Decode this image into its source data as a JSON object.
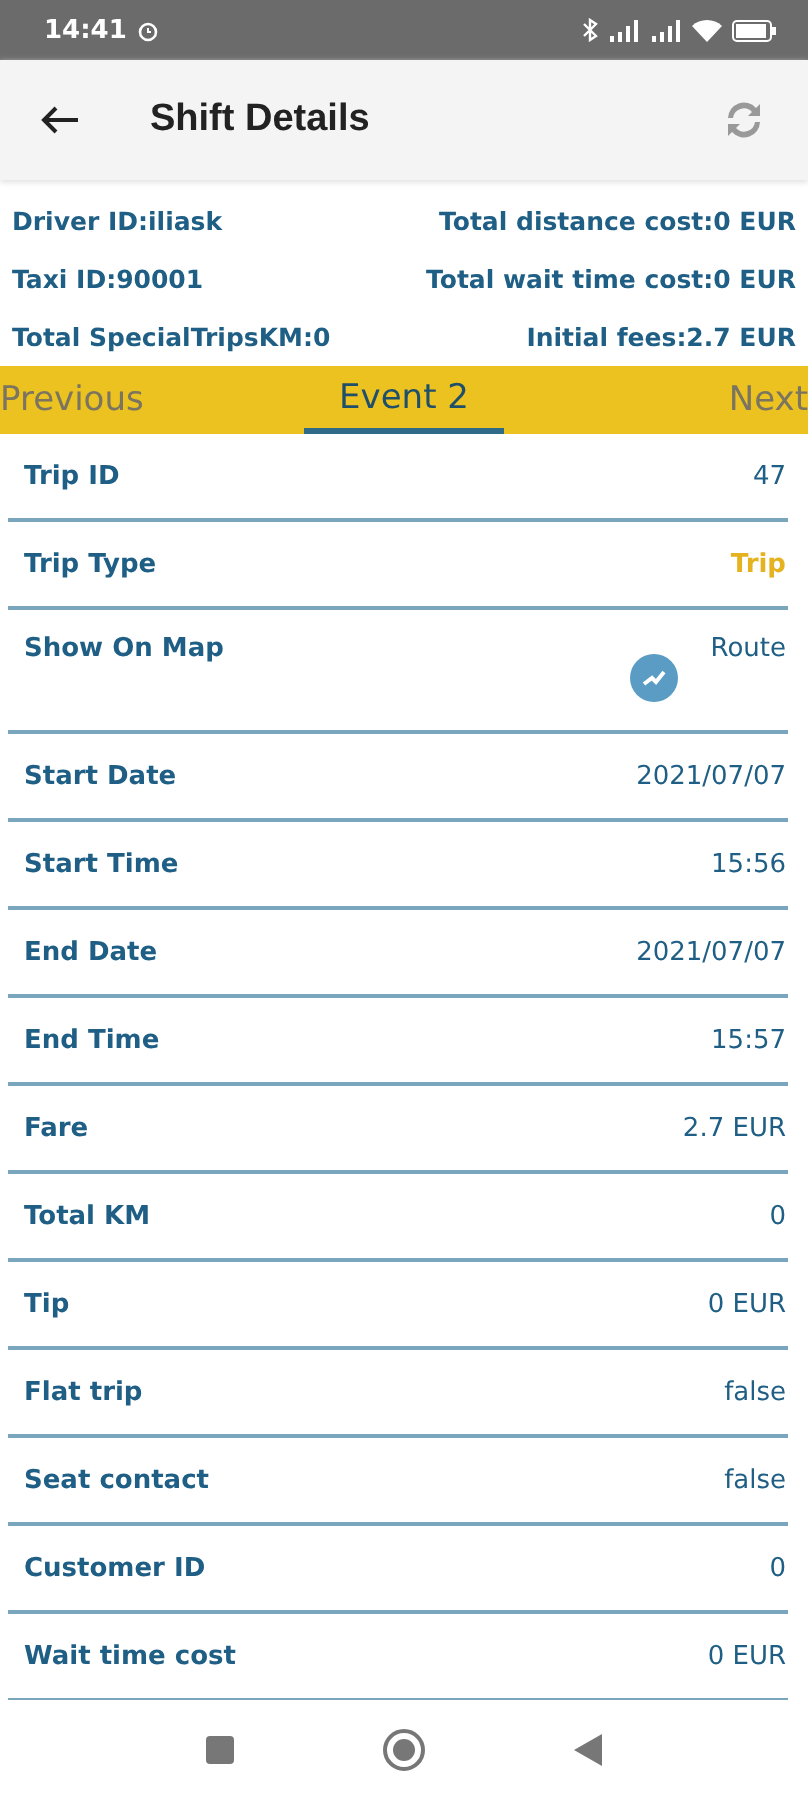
{
  "status_bar": {
    "time": "14:41"
  },
  "app_bar": {
    "title": "Shift Details"
  },
  "summary": [
    {
      "left": "Driver ID:iliask",
      "right": "Total distance cost:0 EUR"
    },
    {
      "left": "Taxi ID:90001",
      "right": "Total wait time cost:0 EUR"
    },
    {
      "left": "Total SpecialTripsKM:0",
      "right": "Initial fees:2.7 EUR"
    }
  ],
  "tabs": [
    {
      "label": "Previous",
      "selected": false
    },
    {
      "label": "Event 2",
      "selected": true
    },
    {
      "label": "Next",
      "selected": false
    }
  ],
  "rows": [
    {
      "kind": "text",
      "label": "Trip ID",
      "value": "47"
    },
    {
      "kind": "type",
      "label": "Trip Type",
      "value": "Trip"
    },
    {
      "kind": "map",
      "label": "Show On Map",
      "value": "Route"
    },
    {
      "kind": "text",
      "label": "Start Date",
      "value": "2021/07/07"
    },
    {
      "kind": "text",
      "label": "Start Time",
      "value": "15:56"
    },
    {
      "kind": "text",
      "label": "End Date",
      "value": "2021/07/07"
    },
    {
      "kind": "text",
      "label": "End Time",
      "value": "15:57"
    },
    {
      "kind": "text",
      "label": "Fare",
      "value": "2.7 EUR"
    },
    {
      "kind": "text",
      "label": "Total KM",
      "value": "0"
    },
    {
      "kind": "text",
      "label": "Tip",
      "value": "0 EUR"
    },
    {
      "kind": "text",
      "label": "Flat trip",
      "value": "false"
    },
    {
      "kind": "text",
      "label": "Seat contact",
      "value": "false"
    },
    {
      "kind": "text",
      "label": "Customer ID",
      "value": "0"
    },
    {
      "kind": "text",
      "label": "Wait time cost",
      "value": "0 EUR"
    }
  ]
}
